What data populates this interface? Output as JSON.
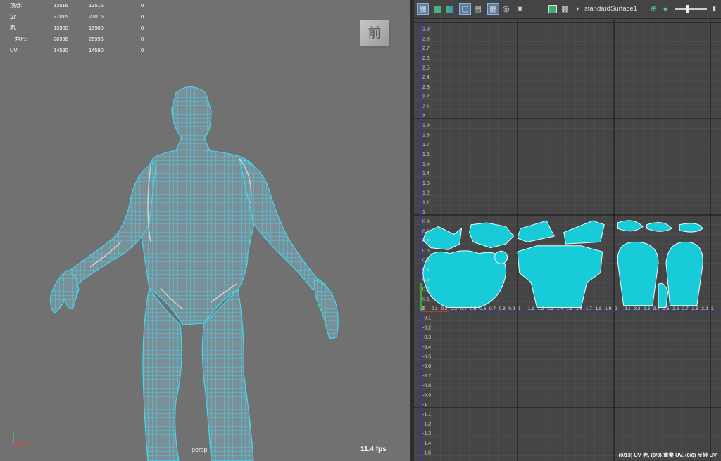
{
  "hud": {
    "rows": [
      {
        "label": "顶点:",
        "v1": "13516",
        "v2": "13516",
        "v3": "0"
      },
      {
        "label": "边:",
        "v1": "27015",
        "v2": "27015",
        "v3": "0"
      },
      {
        "label": "面:",
        "v1": "13500",
        "v2": "13500",
        "v3": "0"
      },
      {
        "label": "三角形:",
        "v1": "26996",
        "v2": "26996",
        "v3": "0"
      },
      {
        "label": "UV:",
        "v1": "14590",
        "v2": "14590",
        "v3": "0"
      }
    ]
  },
  "viewport": {
    "view_cube_label": "前",
    "camera_label": "persp",
    "fps": "11.4 fps",
    "wireframe_color": "#35d6ef"
  },
  "uv_editor": {
    "texture_name": "standardSurface1",
    "status": "(0/13) UV 壳, (0/0) 重叠 UV, (0/0) 反转 UV",
    "shell_color": "#17cbd8",
    "y_ticks": [
      "2.9",
      "2.8",
      "2.7",
      "2.6",
      "2.5",
      "2.4",
      "2.3",
      "2.2",
      "2.1",
      "2",
      "1.9",
      "1.8",
      "1.7",
      "1.6",
      "1.5",
      "1.4",
      "1.3",
      "1.2",
      "1.1",
      "1",
      "0.9",
      "0.8",
      "0.7",
      "0.6",
      "0.5",
      "0.4",
      "0.3",
      "0.2",
      "0.1",
      "0",
      "-0.1",
      "-0.2",
      "-0.3",
      "-0.4",
      "-0.5",
      "-0.6",
      "-0.7",
      "-0.8",
      "-0.9",
      "-1",
      "-1.1",
      "-1.2",
      "-1.3",
      "-1.4",
      "-1.5"
    ],
    "x_ticks": [
      "0",
      "0.1",
      "0.2",
      "0.3",
      "0.4",
      "0.5",
      "0.6",
      "0.7",
      "0.8",
      "0.9",
      "1",
      "1.1",
      "1.2",
      "1.3",
      "1.4",
      "1.5",
      "1.6",
      "1.7",
      "1.8",
      "1.9",
      "2",
      "2.1",
      "2.2",
      "2.3",
      "2.4",
      "2.5",
      "2.6",
      "2.7",
      "2.8",
      "2.9",
      "3"
    ]
  },
  "toolbar": {
    "icons": [
      "uv-grid-icon",
      "uv-shaded-icon",
      "uv-distortion-icon",
      "uv-border-icon",
      "uv-checker-icon",
      "uv-grid-toggle-icon",
      "uv-pixel-snap-icon",
      "uv-snapshot-icon"
    ],
    "texture_icons": [
      "image-icon",
      "checker-pattern-icon",
      "dropdown-icon"
    ],
    "right_icons": [
      "exposure-icon",
      "slider-icon",
      "gamma-icon"
    ]
  }
}
